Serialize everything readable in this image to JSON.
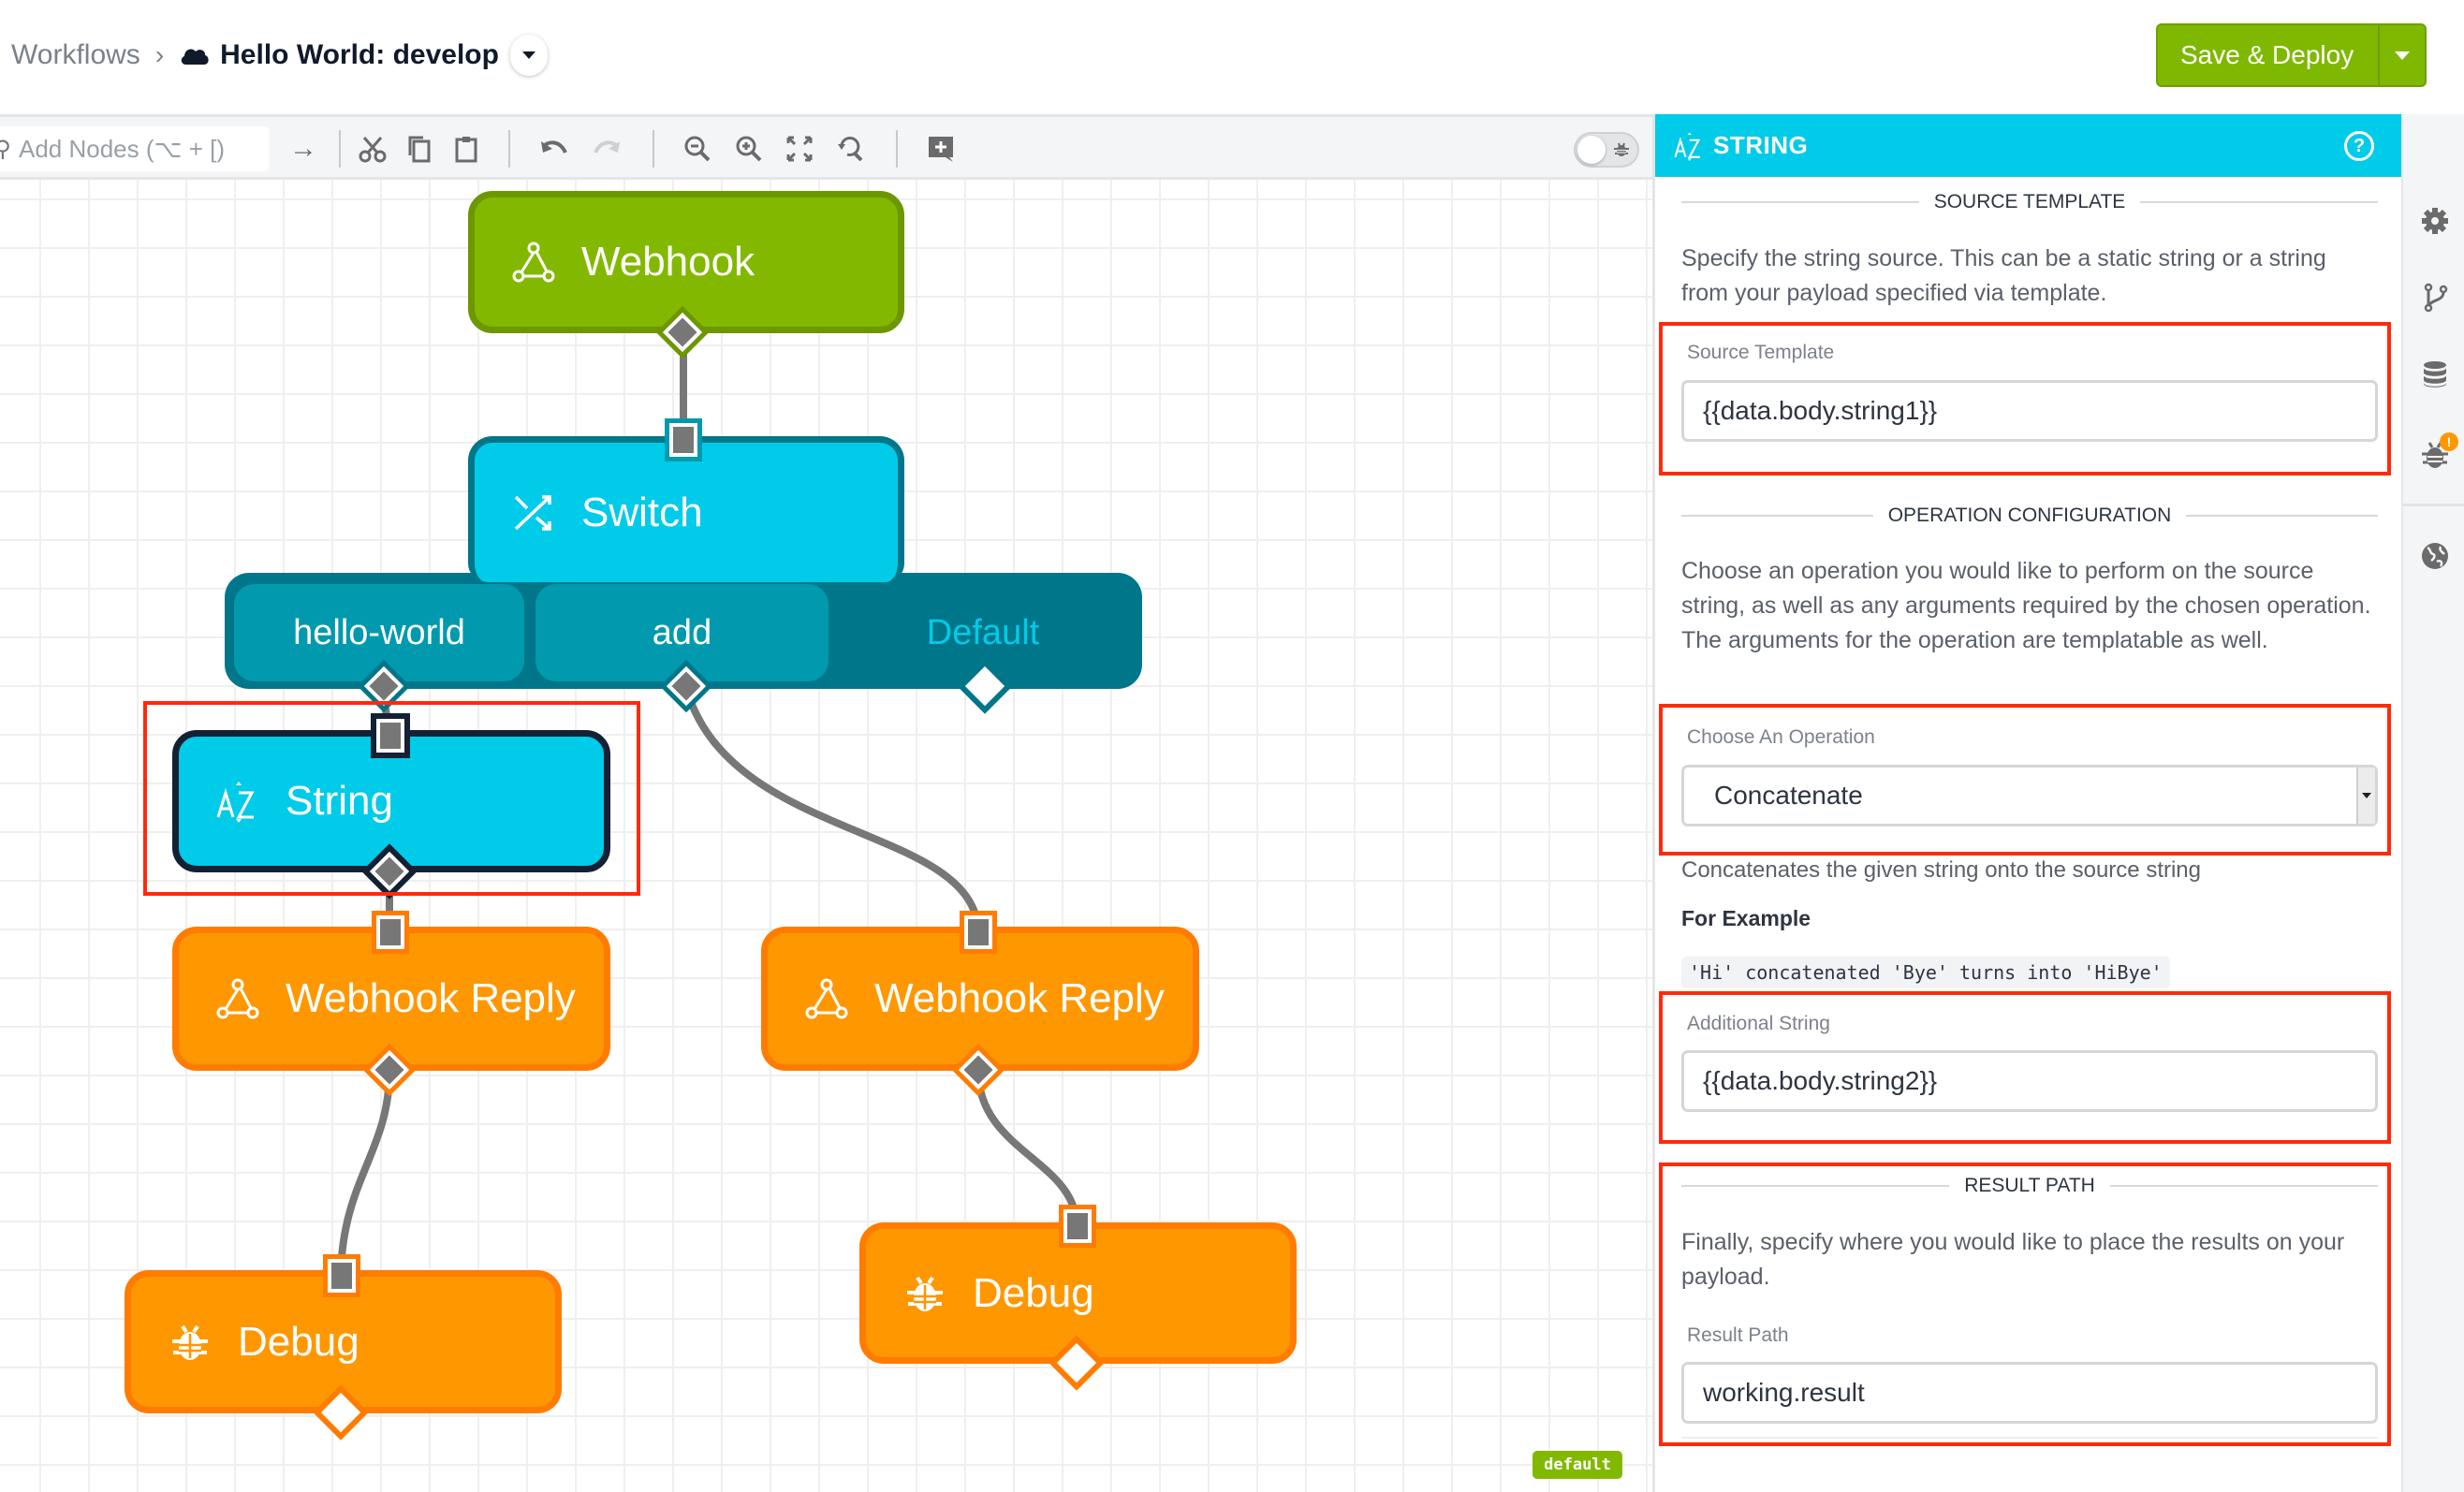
{
  "header": {
    "breadcrumb_root": "Workflows",
    "breadcrumb_sep": "›",
    "workflow_title": "Hello World: develop",
    "deploy_label": "Save & Deploy"
  },
  "toolbar": {
    "add_nodes_placeholder": "Add Nodes (⌥ + [)",
    "icons": [
      "arrow-right-icon",
      "cut-icon",
      "copy-icon",
      "paste-icon",
      "undo-icon",
      "redo-icon",
      "zoom-out-icon",
      "zoom-in-icon",
      "fit-screen-icon",
      "reset-zoom-icon",
      "add-comment-icon"
    ],
    "debug_toggle_on": false
  },
  "canvas": {
    "nodes": {
      "webhook": "Webhook",
      "switch": "Switch",
      "switch_branches": [
        "hello-world",
        "add",
        "Default"
      ],
      "string": "String",
      "webhook_reply_left": "Webhook Reply",
      "webhook_reply_right": "Webhook Reply",
      "debug_left": "Debug",
      "debug_right": "Debug"
    },
    "environment_badge": "default",
    "colors": {
      "trigger": "#83b800",
      "logic": "#00cbe8",
      "output": "#ff9700",
      "selected_border": "#142033",
      "highlight": "#ff2a0a"
    }
  },
  "panel": {
    "title": "STRING",
    "help_label": "?",
    "source_section": {
      "title": "SOURCE TEMPLATE",
      "description": "Specify the string source. This can be a static string or a string from your payload specified via template.",
      "field_label": "Source Template",
      "field_value": "{{data.body.string1}}"
    },
    "operation_section": {
      "title": "OPERATION CONFIGURATION",
      "description": "Choose an operation you would like to perform on the source string, as well as any arguments required by the chosen operation. The arguments for the operation are templatable as well.",
      "select_label": "Choose An Operation",
      "select_value": "Concatenate",
      "operation_help": "Concatenates the given string onto the source string",
      "example_heading": "For Example",
      "example_code": "'Hi' concatenated 'Bye' turns into 'HiBye'",
      "arg_label": "Additional String",
      "arg_value": "{{data.body.string2}}"
    },
    "result_section": {
      "title": "RESULT PATH",
      "description": "Finally, specify where you would like to place the results on your payload.",
      "field_label": "Result Path",
      "field_value": "working.result"
    }
  },
  "rail": {
    "items": [
      "settings-icon",
      "versions-icon",
      "storage-icon",
      "debug-icon",
      "globe-icon"
    ],
    "debug_badge": "!"
  }
}
